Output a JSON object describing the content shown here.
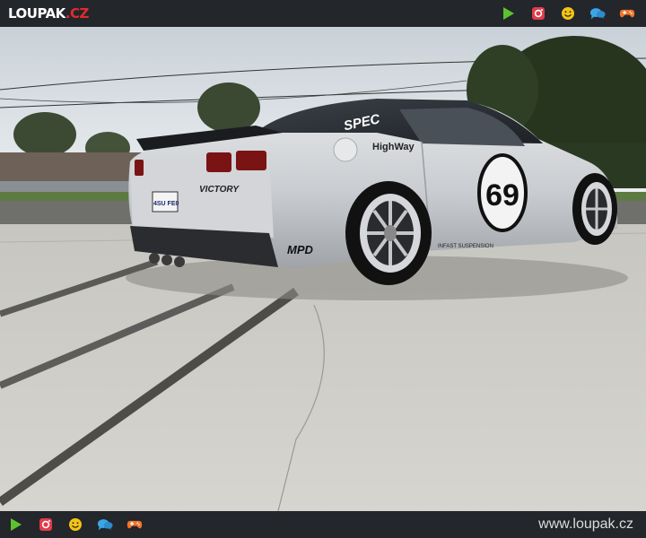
{
  "brand": {
    "name": "LOUPAK",
    "tld": ".CZ"
  },
  "footer": {
    "site_url": "www.loupak.cz"
  },
  "nav_icons": [
    "play-icon",
    "instagram-icon",
    "smiley-icon",
    "chat-icon",
    "gamepad-icon"
  ],
  "colors": {
    "bar": "#23262b",
    "brand_red": "#e32b2b",
    "play": "#5cc32e",
    "instagram": "#e13c4a",
    "smiley": "#f3c417",
    "chat": "#3ba7e8",
    "gamepad": "#f0742a"
  },
  "photo": {
    "plate": "4SU FE0",
    "race_number": "69",
    "rear_brand": "MPD",
    "window_sticker": "SPEC",
    "side_sticker": "HighWay",
    "bumper_sticker": "VICTORY",
    "suspension_sticker": "INFAST SUSPENSION"
  }
}
